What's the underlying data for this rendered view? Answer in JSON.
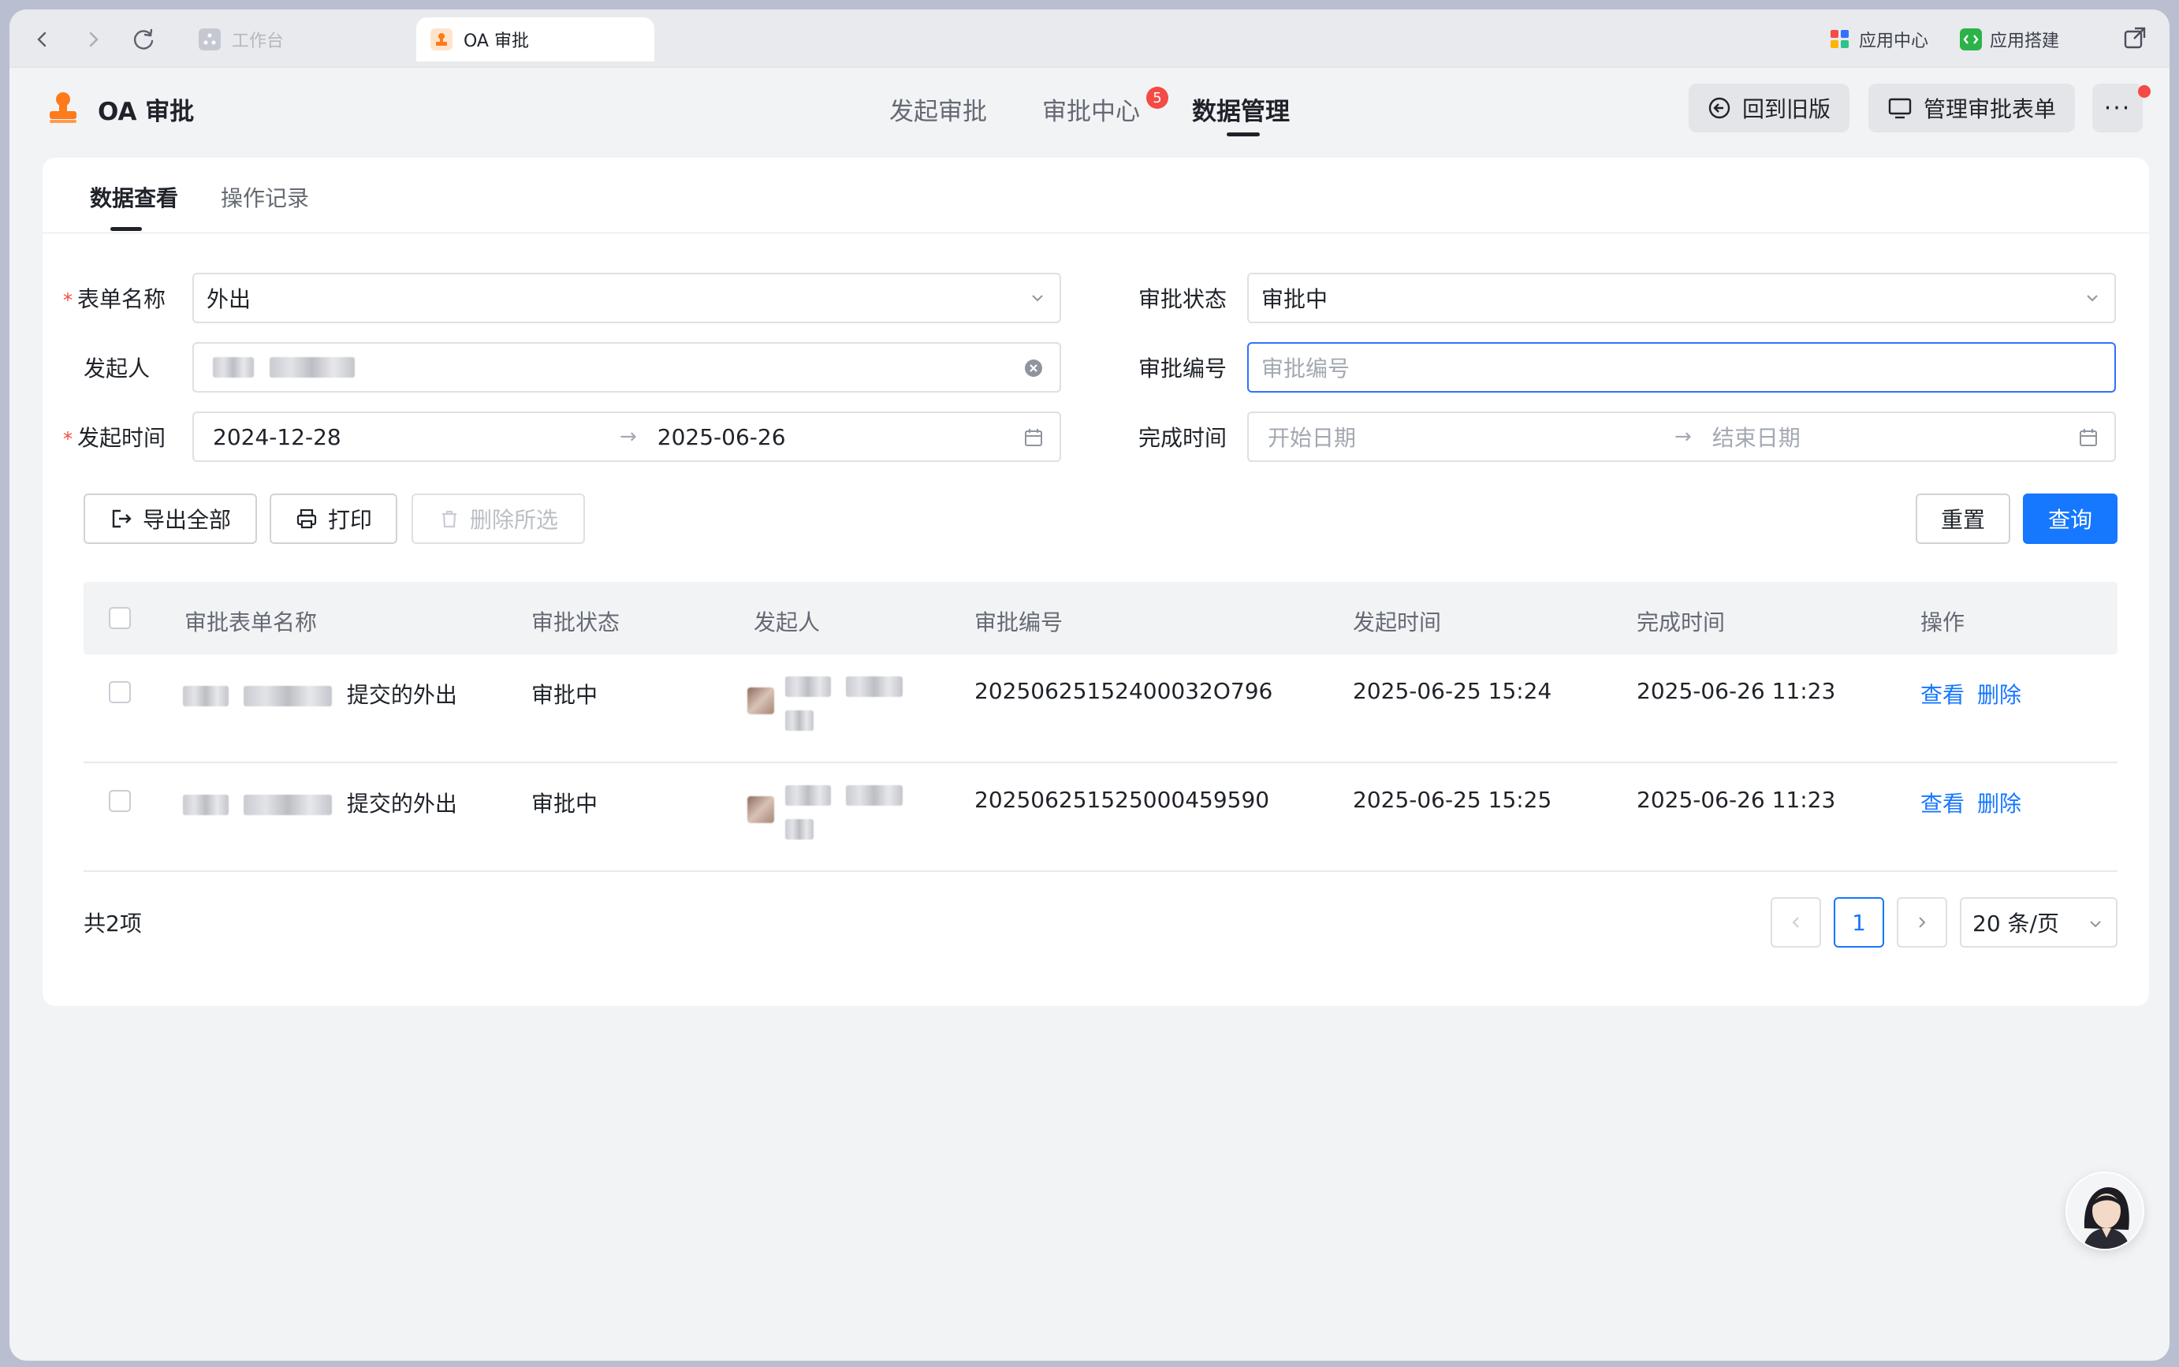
{
  "browser": {
    "tabs": [
      {
        "label": "工作台",
        "active": false
      },
      {
        "label": "OA 审批",
        "active": true
      }
    ],
    "right_links": [
      {
        "label": "应用中心",
        "icon": "app-center-icon"
      },
      {
        "label": "应用搭建",
        "icon": "app-builder-icon"
      }
    ]
  },
  "header": {
    "app_title": "OA 审批",
    "nav": [
      {
        "label": "发起审批",
        "active": false
      },
      {
        "label": "审批中心",
        "active": false,
        "badge": "5"
      },
      {
        "label": "数据管理",
        "active": true
      }
    ],
    "back_old_label": "回到旧版",
    "manage_forms_label": "管理审批表单",
    "more_label": "···"
  },
  "subtabs": [
    {
      "label": "数据查看",
      "active": true
    },
    {
      "label": "操作记录",
      "active": false
    }
  ],
  "filters": {
    "form_name": {
      "label": "表单名称",
      "required": true,
      "value": "外出"
    },
    "status": {
      "label": "审批状态",
      "value": "审批中"
    },
    "initiator": {
      "label": "发起人"
    },
    "approval_no": {
      "label": "审批编号",
      "placeholder": "审批编号"
    },
    "start_time": {
      "label": "发起时间",
      "required": true,
      "from": "2024-12-28",
      "to": "2025-06-26"
    },
    "finish_time": {
      "label": "完成时间",
      "from_placeholder": "开始日期",
      "to_placeholder": "结束日期"
    }
  },
  "actions": {
    "export_all": "导出全部",
    "print": "打印",
    "delete_selected": "删除所选",
    "reset": "重置",
    "query": "查询"
  },
  "table": {
    "columns": [
      "审批表单名称",
      "审批状态",
      "发起人",
      "审批编号",
      "发起时间",
      "完成时间",
      "操作"
    ],
    "rows": [
      {
        "title_suffix": "提交的外出",
        "status": "审批中",
        "no": "20250625152400032O796",
        "start": "2025-06-25 15:24",
        "finish": "2025-06-26 11:23",
        "view": "查看",
        "delete": "删除"
      },
      {
        "title_suffix": "提交的外出",
        "status": "审批中",
        "no": "202506251525000459590",
        "start": "2025-06-25 15:25",
        "finish": "2025-06-26 11:23",
        "view": "查看",
        "delete": "删除"
      }
    ]
  },
  "pagination": {
    "total": "共2项",
    "current_page": "1",
    "page_size": "20 条/页"
  },
  "colors": {
    "primary": "#1677ff",
    "badge": "#f54a45",
    "logo": "#ff7a1a"
  }
}
